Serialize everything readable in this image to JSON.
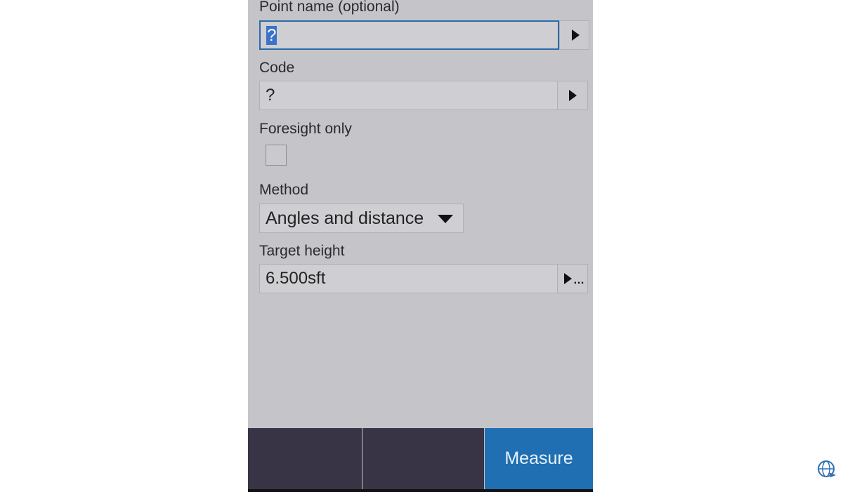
{
  "form": {
    "point_name_label": "Point name (optional)",
    "point_name_value": "?",
    "code_label": "Code",
    "code_value": "?",
    "foresight_label": "Foresight only",
    "foresight_checked": false,
    "method_label": "Method",
    "method_value": "Angles and distance",
    "target_height_label": "Target height",
    "target_height_value": "6.500sft"
  },
  "footer": {
    "measure_label": "Measure"
  },
  "colors": {
    "panel_bg": "#c5c5c9",
    "footer_dark": "#383445",
    "accent": "#1f6fb2",
    "focus_border": "#2b6aa8"
  },
  "icons": {
    "point_name_next": "triangle-right-icon",
    "code_next": "triangle-right-icon",
    "method_dropdown": "triangle-down-icon",
    "target_height_menu": "triangle-right-ellipsis-icon",
    "brand_logo": "globe-logo"
  }
}
